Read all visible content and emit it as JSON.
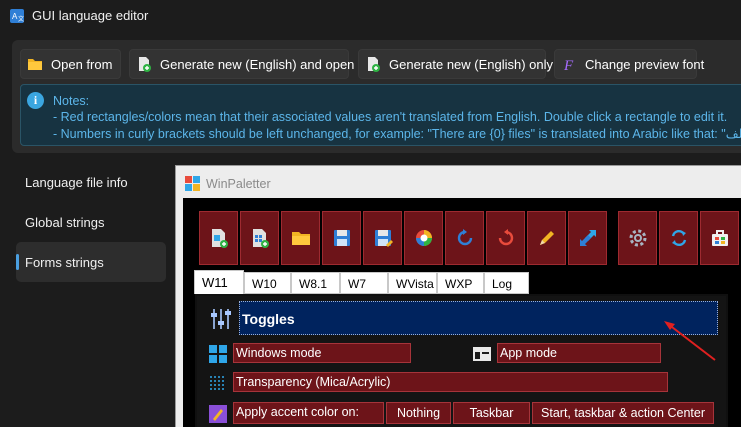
{
  "window": {
    "title": "GUI language editor"
  },
  "toolbar": {
    "open_from": "Open from",
    "generate_open": "Generate new (English) and open It",
    "generate_only": "Generate new (English) only",
    "change_font": "Change preview font"
  },
  "notes": {
    "heading": "Notes:",
    "line1": "- Red rectangles/colors mean that their associated values aren't translated from English. Double click a rectangle to edit it.",
    "line2": "- Numbers in curly brackets should be left unchanged, for example: \"There are {0} files\" is translated into Arabic like that: \"ملف"
  },
  "sidebar": {
    "items": [
      {
        "label": "Language file info"
      },
      {
        "label": "Global strings"
      },
      {
        "label": "Forms strings",
        "active": true
      }
    ]
  },
  "preview": {
    "title": "WinPaletter",
    "tabs": [
      "W11",
      "W10",
      "W8.1",
      "W7",
      "WVista",
      "WXP",
      "Log"
    ],
    "active_tab": "W11",
    "toggles_header": "Toggles",
    "windows_mode": "Windows mode",
    "app_mode": "App mode",
    "transparency": "Transparency (Mica/Acrylic)",
    "accent_label": "Apply accent color on:",
    "accent_options": [
      "Nothing",
      "Taskbar",
      "Start, taskbar & action Center"
    ]
  },
  "colors": {
    "untranslated": "#6d1419",
    "info_text": "#5cb6ea",
    "accent": "#4a9fe0"
  }
}
